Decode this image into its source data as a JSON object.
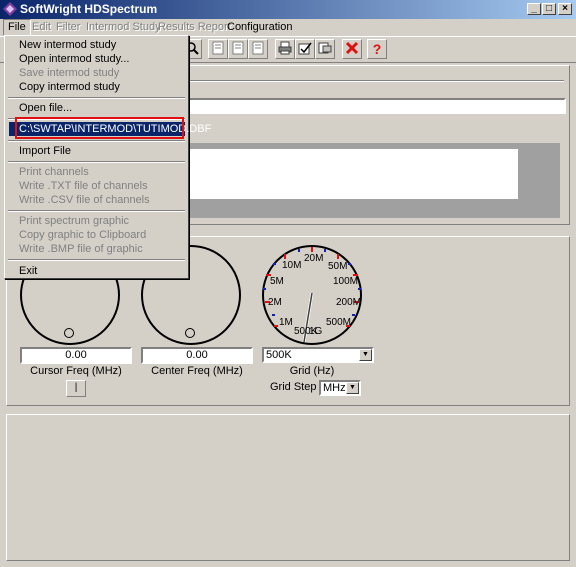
{
  "window": {
    "title": "SoftWright HDSpectrum",
    "minimize_glyph": "_",
    "maximize_glyph": "□",
    "close_glyph": "×"
  },
  "menubar": {
    "file": "File",
    "edit": "Edit",
    "filter": "Filter",
    "intermod": "Intermod Study",
    "results": "Results Report",
    "config": "Configuration"
  },
  "file_menu": {
    "new_study": "New intermod study",
    "open_study": "Open intermod study...",
    "save_study": "Save intermod study",
    "copy_study": "Copy intermod study",
    "open_file": "Open file...",
    "recent_file": "C:\\SWTAP\\INTERMOD\\TUTIMOD.DBF",
    "import_file": "Import File",
    "print_channels": "Print channels",
    "write_txt": "Write .TXT file of channels",
    "write_csv": "Write .CSV file of channels",
    "print_spectrum": "Print spectrum graphic",
    "copy_graphic": "Copy graphic to Clipboard",
    "write_bmp": "Write .BMP file of graphic",
    "exit": "Exit"
  },
  "controls": {
    "cursor_freq_value": "0.00",
    "cursor_freq_label": "Cursor Freq (MHz)",
    "cursor_button_label": "|",
    "center_freq_value": "0.00",
    "center_freq_label": "Center Freq (MHz)",
    "grid_value": "500K",
    "grid_label": "Grid (Hz)",
    "grid_step_label": "Grid Step",
    "grid_step_value": "MHz"
  },
  "grid_dial_labels": [
    "20M",
    "50M",
    "100M",
    "200M",
    "500M",
    "1G",
    "500K",
    "1M",
    "2M",
    "5M",
    "10M"
  ],
  "toolbar_icons": [
    "zoom-icon",
    "page-icon",
    "page-icon",
    "page-icon",
    "print-icon",
    "check-icon",
    "export-icon",
    "delete-icon",
    "help-icon"
  ],
  "accent_colors": {
    "title_bar": "#0a246a",
    "selection": "#0a246a",
    "highlight_border": "#e01010",
    "delete_red": "#e01010"
  }
}
